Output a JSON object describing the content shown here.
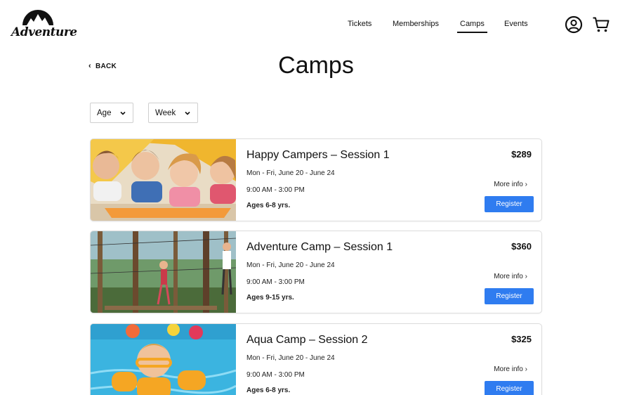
{
  "brand": {
    "logo_text": "Adventure"
  },
  "nav": {
    "items": [
      {
        "label": "Tickets",
        "active": false
      },
      {
        "label": "Memberships",
        "active": false
      },
      {
        "label": "Camps",
        "active": true
      },
      {
        "label": "Events",
        "active": false
      }
    ]
  },
  "header_icons": {
    "account": "user-circle-icon",
    "cart": "shopping-cart-icon"
  },
  "page": {
    "back_label": "BACK",
    "title": "Camps"
  },
  "filters": {
    "age": {
      "label": "Age",
      "icon": "chevron-down-icon"
    },
    "week": {
      "label": "Week",
      "icon": "chevron-down-icon"
    }
  },
  "camps": [
    {
      "title": "Happy Campers – Session 1",
      "dates": "Mon - Fri, June 20 - June 24",
      "time": "9:00 AM - 3:00 PM",
      "ages": "Ages 6-8 yrs.",
      "price": "$289",
      "more_info": "More info",
      "register": "Register"
    },
    {
      "title": "Adventure Camp – Session 1",
      "dates": "Mon - Fri, June 20 - June 24",
      "time": "9:00 AM - 3:00 PM",
      "ages": "Ages 9-15 yrs.",
      "price": "$360",
      "more_info": "More info",
      "register": "Register"
    },
    {
      "title": "Aqua Camp – Session 2",
      "dates": "Mon - Fri, June 20 - June 24",
      "time": "9:00 AM - 3:00 PM",
      "ages": "Ages 6-8 yrs.",
      "price": "$325",
      "more_info": "More info",
      "register": "Register"
    }
  ],
  "colors": {
    "accent": "#2f7cf0",
    "border": "#dcdcdc",
    "text": "#111111"
  }
}
